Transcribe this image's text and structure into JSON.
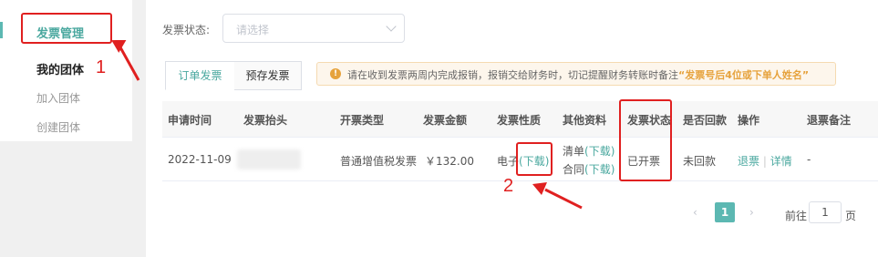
{
  "sidebar": {
    "items": [
      {
        "label": "发票管理"
      },
      {
        "label": "我的团体"
      },
      {
        "label": "加入团体"
      },
      {
        "label": "创建团体"
      }
    ]
  },
  "filter": {
    "label": "发票状态:",
    "placeholder": "请选择"
  },
  "tabs": [
    {
      "label": "订单发票",
      "active": true
    },
    {
      "label": "预存发票",
      "active": false
    }
  ],
  "notice": {
    "icon": "warning-icon",
    "text": "请在收到发票两周内完成报销，报销交给财务时，切记提醒财务转账时备注",
    "highlight": "“发票号后4位或下单人姓名”"
  },
  "table": {
    "columns": [
      "申请时间",
      "发票抬头",
      "开票类型",
      "发票金额",
      "发票性质",
      "其他资料",
      "发票状态",
      "是否回款",
      "操作",
      "退票备注"
    ],
    "rows": [
      {
        "apply_time": "2022-11-09",
        "title": "",
        "invoice_type": "普通增值税发票",
        "amount": "￥132.00",
        "nature": "电子",
        "nature_link": "(下载)",
        "other_1": "清单",
        "other_1_link": "(下载)",
        "other_2": "合同",
        "other_2_link": "(下载)",
        "status": "已开票",
        "payment": "未回款",
        "op_refund": "退票",
        "op_sep": "|",
        "op_detail": "详情",
        "remark": "-"
      }
    ]
  },
  "pagination": {
    "current": "1",
    "goto_label": "前往",
    "goto_value": "1",
    "goto_suffix": "页"
  },
  "annotations": {
    "num1": "1",
    "num2": "2",
    "color": "#e02020"
  },
  "colors": {
    "accent": "#4aa89f",
    "warning": "#e6a23c"
  }
}
